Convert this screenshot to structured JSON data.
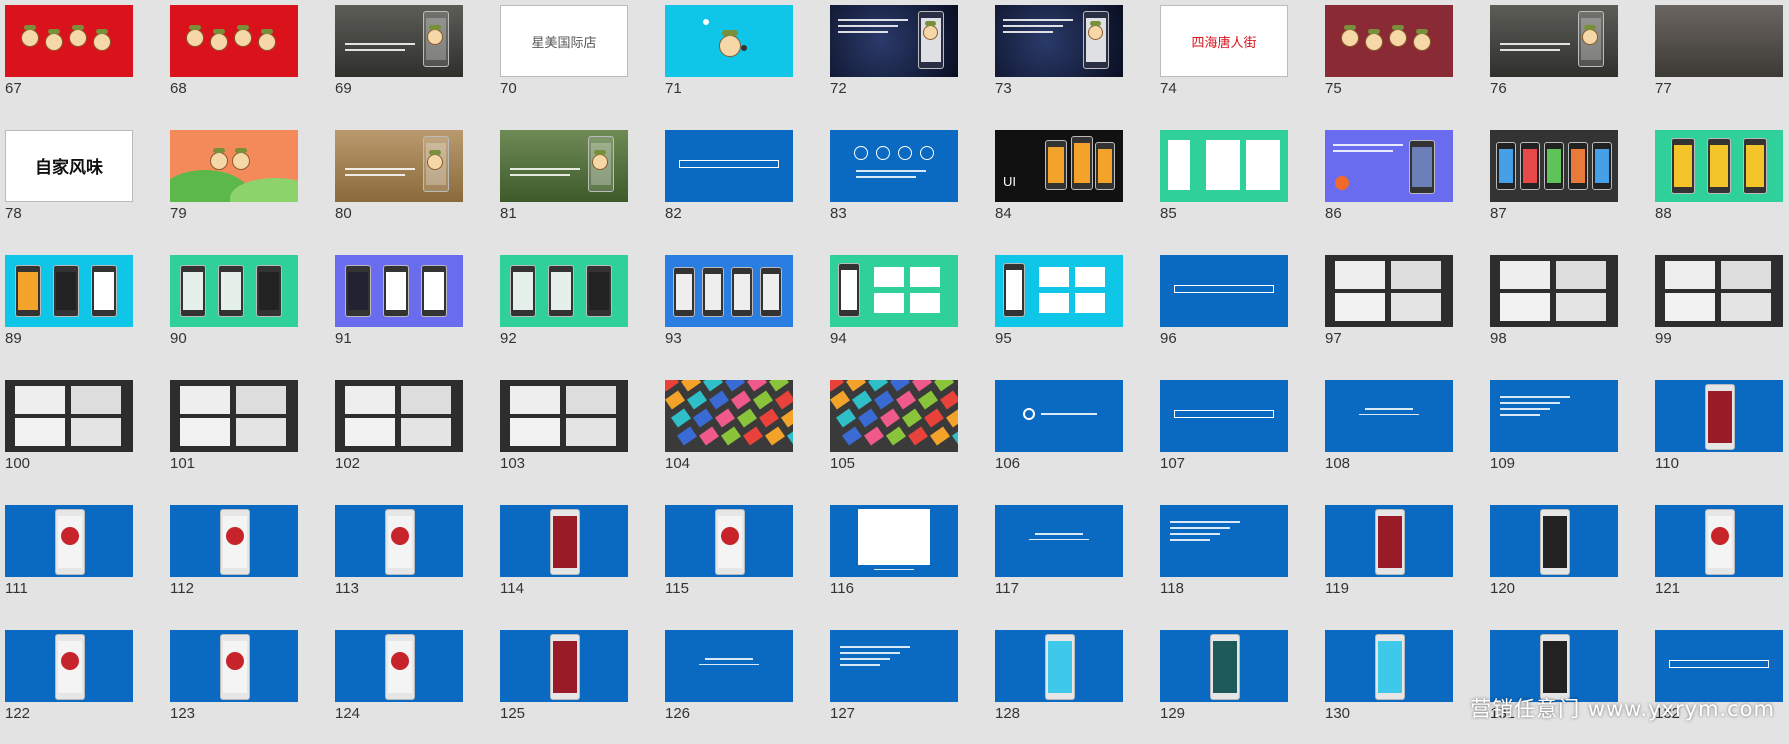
{
  "watermark": "营销任意门 www.yxrym.com",
  "colors": {
    "blue": "#0a6ac1",
    "red": "#d9121b",
    "teal": "#2fd09a",
    "cyan": "#10c6e8",
    "purple": "#6a6cf0",
    "dark": "#2d2d2d",
    "maroon": "#8a2a34",
    "white": "#ffffff"
  },
  "slides": [
    {
      "num": "67",
      "kind": "red-mascots"
    },
    {
      "num": "68",
      "kind": "red-mascots"
    },
    {
      "num": "69",
      "kind": "photo-phone"
    },
    {
      "num": "70",
      "kind": "logo",
      "text": "星美国际店"
    },
    {
      "num": "71",
      "kind": "cyan-mascot"
    },
    {
      "num": "72",
      "kind": "space-phone"
    },
    {
      "num": "73",
      "kind": "space-phone"
    },
    {
      "num": "74",
      "kind": "logo-red",
      "text": "四海唐人街"
    },
    {
      "num": "75",
      "kind": "maroon-mascots"
    },
    {
      "num": "76",
      "kind": "photo-phone"
    },
    {
      "num": "77",
      "kind": "photo-old"
    },
    {
      "num": "78",
      "kind": "calligraphy",
      "text": "自家风味"
    },
    {
      "num": "79",
      "kind": "hills-mascot"
    },
    {
      "num": "80",
      "kind": "wheat-phone"
    },
    {
      "num": "81",
      "kind": "field-phone"
    },
    {
      "num": "82",
      "kind": "blue-title"
    },
    {
      "num": "83",
      "kind": "blue-circles"
    },
    {
      "num": "84",
      "kind": "black-ui",
      "text": "UI"
    },
    {
      "num": "85",
      "kind": "teal-cards"
    },
    {
      "num": "86",
      "kind": "purple-phone"
    },
    {
      "num": "87",
      "kind": "dark-phones"
    },
    {
      "num": "88",
      "kind": "teal-phones"
    },
    {
      "num": "89",
      "kind": "cyan-phones"
    },
    {
      "num": "90",
      "kind": "teal-phones2"
    },
    {
      "num": "91",
      "kind": "purple-phones"
    },
    {
      "num": "92",
      "kind": "teal-phones3"
    },
    {
      "num": "93",
      "kind": "blue-phones"
    },
    {
      "num": "94",
      "kind": "teal-products"
    },
    {
      "num": "95",
      "kind": "cyan-products"
    },
    {
      "num": "96",
      "kind": "blue-title"
    },
    {
      "num": "97",
      "kind": "dark-photos"
    },
    {
      "num": "98",
      "kind": "dark-photos"
    },
    {
      "num": "99",
      "kind": "dark-photos"
    },
    {
      "num": "100",
      "kind": "dark-photos"
    },
    {
      "num": "101",
      "kind": "dark-photos"
    },
    {
      "num": "102",
      "kind": "dark-photos"
    },
    {
      "num": "103",
      "kind": "dark-photos"
    },
    {
      "num": "104",
      "kind": "packs"
    },
    {
      "num": "105",
      "kind": "packs"
    },
    {
      "num": "106",
      "kind": "blue-logo"
    },
    {
      "num": "107",
      "kind": "blue-title"
    },
    {
      "num": "108",
      "kind": "blue-small"
    },
    {
      "num": "109",
      "kind": "blue-text"
    },
    {
      "num": "110",
      "kind": "blue-phone-red"
    },
    {
      "num": "111",
      "kind": "blue-phone-white"
    },
    {
      "num": "112",
      "kind": "blue-phone-white"
    },
    {
      "num": "113",
      "kind": "blue-phone-white"
    },
    {
      "num": "114",
      "kind": "blue-phone-red"
    },
    {
      "num": "115",
      "kind": "blue-phone-white"
    },
    {
      "num": "116",
      "kind": "blue-screenshot"
    },
    {
      "num": "117",
      "kind": "blue-small"
    },
    {
      "num": "118",
      "kind": "blue-text"
    },
    {
      "num": "119",
      "kind": "blue-phone-red"
    },
    {
      "num": "120",
      "kind": "blue-phone-dark"
    },
    {
      "num": "121",
      "kind": "blue-phone-white"
    },
    {
      "num": "122",
      "kind": "blue-phone-white"
    },
    {
      "num": "123",
      "kind": "blue-phone-white"
    },
    {
      "num": "124",
      "kind": "blue-phone-white"
    },
    {
      "num": "125",
      "kind": "blue-phone-red"
    },
    {
      "num": "126",
      "kind": "blue-small"
    },
    {
      "num": "127",
      "kind": "blue-text"
    },
    {
      "num": "128",
      "kind": "blue-phone-cyan"
    },
    {
      "num": "129",
      "kind": "blue-phone-teal"
    },
    {
      "num": "130",
      "kind": "blue-phone-cyan"
    },
    {
      "num": "131",
      "kind": "blue-phone-dark"
    },
    {
      "num": "132",
      "kind": "blue-title"
    }
  ]
}
